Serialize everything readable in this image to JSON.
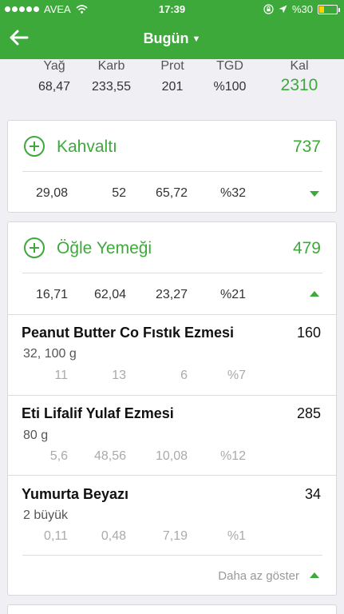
{
  "status": {
    "carrier": "AVEA",
    "time": "17:39",
    "battery": "%30",
    "battery_level": 0.3
  },
  "nav": {
    "title": "Bugün"
  },
  "summary": {
    "fat": {
      "label": "Yağ",
      "value": "68,47"
    },
    "carb": {
      "label": "Karb",
      "value": "233,55"
    },
    "prot": {
      "label": "Prot",
      "value": "201"
    },
    "tgd": {
      "label": "TGD",
      "value": "%100"
    },
    "kal": {
      "label": "Kal",
      "value": "2310"
    }
  },
  "meals": [
    {
      "name": "Kahvaltı",
      "kcal": "737",
      "fat": "29,08",
      "carb": "52",
      "prot": "65,72",
      "pct": "%32"
    },
    {
      "name": "Öğle Yemeği",
      "kcal": "479",
      "fat": "16,71",
      "carb": "62,04",
      "prot": "23,27",
      "pct": "%21",
      "foods": [
        {
          "name": "Peanut Butter Co Fıstık Ezmesi",
          "kcal": "160",
          "serving": "32, 100 g",
          "fat": "11",
          "carb": "13",
          "prot": "6",
          "pct": "%7"
        },
        {
          "name": "Eti Lifalif Yulaf Ezmesi",
          "kcal": "285",
          "serving": "80 g",
          "fat": "5,6",
          "carb": "48,56",
          "prot": "10,08",
          "pct": "%12"
        },
        {
          "name": "Yumurta Beyazı",
          "kcal": "34",
          "serving": "2 büyük",
          "fat": "0,11",
          "carb": "0,48",
          "prot": "7,19",
          "pct": "%1"
        }
      ],
      "show_less": "Daha az göster"
    }
  ],
  "colors": {
    "accent": "#3ea93b",
    "background": "#efeff4",
    "battery": "#ffd400"
  },
  "icons": {
    "back": "arrow-left-icon",
    "wifi": "wifi-icon",
    "lock": "rotation-lock-icon",
    "location": "location-arrow-icon"
  }
}
